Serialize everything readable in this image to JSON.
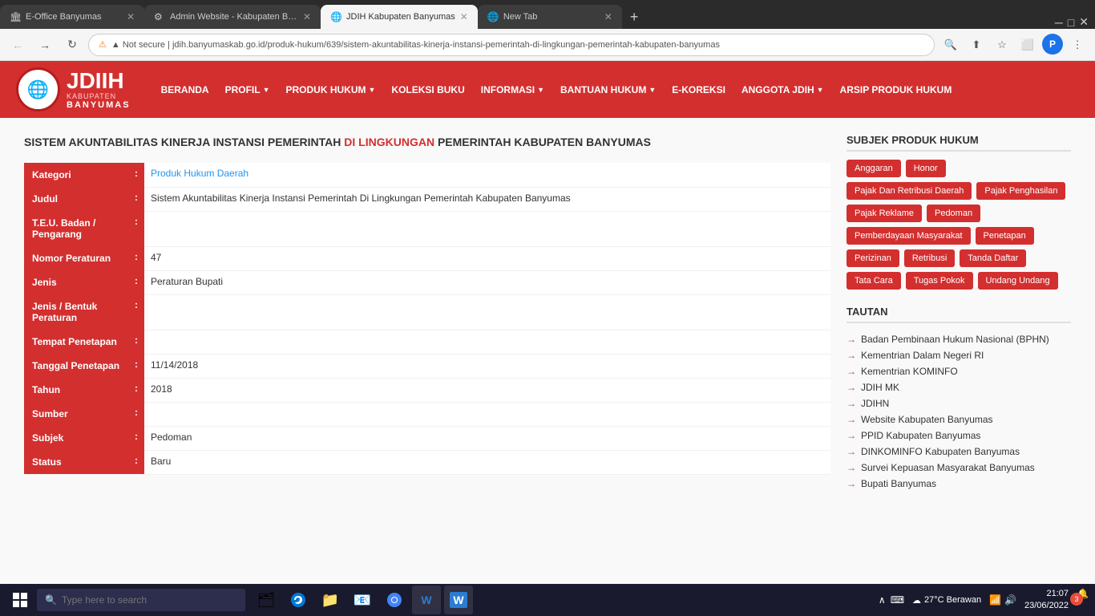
{
  "browser": {
    "tabs": [
      {
        "id": "tab1",
        "title": "E-Office Banyumas",
        "favicon": "🏛",
        "active": false
      },
      {
        "id": "tab2",
        "title": "Admin Website - Kabupaten Ban...",
        "favicon": "⚙",
        "active": false
      },
      {
        "id": "tab3",
        "title": "JDIH Kabupaten Banyumas",
        "favicon": "🌐",
        "active": true
      },
      {
        "id": "tab4",
        "title": "New Tab",
        "favicon": "🌐",
        "active": false
      }
    ],
    "url": "jdih.banyumaskab.go.id/produk-hukum/639/sistem-akuntabilitas-kinerja-instansi-pemerintah-di-lingkungan-pemerintah-kabupaten-banyumas",
    "full_url": "▲ Not secure  |  jdih.banyumaskab.go.id/produk-hukum/639/sistem-akuntabilitas-kinerja-instansi-pemerintah-di-lingkungan-pemerintah-kabupaten-banyumas"
  },
  "navbar": {
    "logo_jdihn": "JDIIH",
    "logo_kabupaten": "KABUPATEN",
    "logo_banyumas": "BANYUMAS",
    "menu": [
      {
        "label": "BERANDA",
        "has_dropdown": false
      },
      {
        "label": "PROFIL",
        "has_dropdown": true
      },
      {
        "label": "PRODUK HUKUM",
        "has_dropdown": true
      },
      {
        "label": "KOLEKSI BUKU",
        "has_dropdown": false
      },
      {
        "label": "INFORMASI",
        "has_dropdown": true
      },
      {
        "label": "BANTUAN HUKUM",
        "has_dropdown": true
      },
      {
        "label": "E-KOREKSI",
        "has_dropdown": false
      },
      {
        "label": "ANGGOTA JDIH",
        "has_dropdown": true
      },
      {
        "label": "ARSIP PRODUK HUKUM",
        "has_dropdown": false
      }
    ]
  },
  "page_title": {
    "text": "SISTEM AKUNTABILITAS KINERJA INSTANSI PEMERINTAH DI LINGKUNGAN PEMERINTAH KABUPATEN BANYUMAS",
    "highlighted_words": [
      "DI",
      "LINGKUNGAN"
    ]
  },
  "detail_rows": [
    {
      "label": "Kategori",
      "value": "Produk Hukum Daerah",
      "is_link": true
    },
    {
      "label": "Judul",
      "value": "Sistem Akuntabilitas Kinerja Instansi Pemerintah Di Lingkungan Pemerintah Kabupaten Banyumas",
      "is_link": false
    },
    {
      "label": "T.E.U. Badan / Pengarang",
      "value": "",
      "is_link": false
    },
    {
      "label": "Nomor Peraturan",
      "value": "47",
      "is_link": false
    },
    {
      "label": "Jenis",
      "value": "Peraturan Bupati",
      "is_link": false
    },
    {
      "label": "Jenis / Bentuk Peraturan",
      "value": "",
      "is_link": false
    },
    {
      "label": "Tempat Penetapan",
      "value": "",
      "is_link": false
    },
    {
      "label": "Tanggal Penetapan",
      "value": "11/14/2018",
      "is_link": false
    },
    {
      "label": "Tahun",
      "value": "2018",
      "is_link": false
    },
    {
      "label": "Sumber",
      "value": "",
      "is_link": false
    },
    {
      "label": "Subjek",
      "value": "Pedoman",
      "is_link": false
    },
    {
      "label": "Status",
      "value": "Baru",
      "is_link": false
    }
  ],
  "sidebar": {
    "subjects_title": "SUBJEK PRODUK HUKUM",
    "tags": [
      "Anggaran",
      "Honor",
      "Pajak Dan Retribusi Daerah",
      "Pajak Penghasilan",
      "Pajak Reklame",
      "Pedoman",
      "Pemberdayaan Masyarakat",
      "Penetapan",
      "Perizinan",
      "Retribusi",
      "Tanda Daftar",
      "Tata Cara",
      "Tugas Pokok",
      "Undang Undang"
    ],
    "links_title": "TAUTAN",
    "links": [
      "Badan Pembinaan Hukum Nasional (BPHN)",
      "Kementrian Dalam Negeri RI",
      "Kementrian KOMINFO",
      "JDIH MK",
      "JDIHN",
      "Website Kabupaten Banyumas",
      "PPID Kabupaten Banyumas",
      "DINKOMINFO Kabupaten Banyumas",
      "Survei Kepuasan Masyarakat Banyumas",
      "Bupati Banyumas"
    ]
  },
  "taskbar": {
    "search_placeholder": "Type here to search",
    "time": "21:07",
    "date": "23/06/2022",
    "weather": "27°C  Berawan",
    "notification_count": "3"
  }
}
